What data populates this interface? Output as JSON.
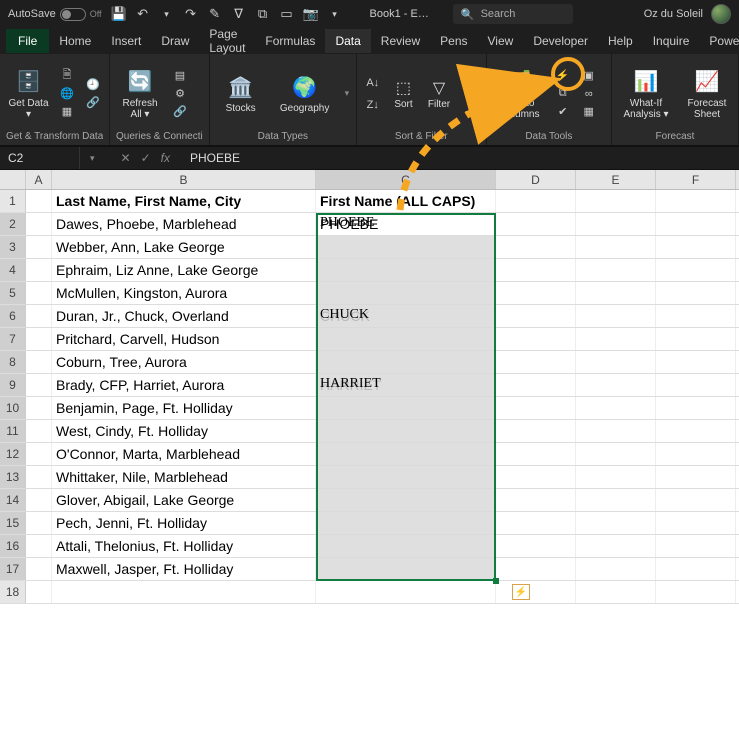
{
  "titlebar": {
    "autosave_label": "AutoSave",
    "autosave_state": "Off",
    "doc_title": "Book1 - E…",
    "search_placeholder": "Search",
    "user_name": "Oz du Soleil"
  },
  "tabs": [
    "File",
    "Home",
    "Insert",
    "Draw",
    "Page Layout",
    "Formulas",
    "Data",
    "Review",
    "Pens",
    "View",
    "Developer",
    "Help",
    "Inquire",
    "Power"
  ],
  "active_tab": "Data",
  "ribbon": {
    "groups": [
      {
        "label": "Get & Transform Data",
        "items": [
          {
            "name": "Get Data ▾"
          }
        ]
      },
      {
        "label": "Queries & Connecti...",
        "items": [
          {
            "name": "Refresh All ▾"
          }
        ]
      },
      {
        "label": "Data Types",
        "items": [
          {
            "name": "Stocks"
          },
          {
            "name": "Geography"
          }
        ]
      },
      {
        "label": "Sort & Filter",
        "items": [
          {
            "name": "Sort"
          },
          {
            "name": "Filter"
          }
        ]
      },
      {
        "label": "Data Tools",
        "items": [
          {
            "name": "Text to Columns"
          }
        ]
      },
      {
        "label": "Forecast",
        "items": [
          {
            "name": "What-If Analysis ▾"
          },
          {
            "name": "Forecast Sheet"
          }
        ]
      }
    ]
  },
  "formula_bar": {
    "name_box": "C2",
    "value": "PHOEBE"
  },
  "columns": [
    "A",
    "B",
    "C",
    "D",
    "E",
    "F"
  ],
  "rows": [
    {
      "n": 1,
      "b": "Last Name, First Name, City",
      "c": "First Name (ALL CAPS)"
    },
    {
      "n": 2,
      "b": "Dawes, Phoebe, Marblehead",
      "c": "PHOEBE"
    },
    {
      "n": 3,
      "b": "Webber, Ann, Lake George",
      "c": ""
    },
    {
      "n": 4,
      "b": "Ephraim, Liz Anne, Lake George",
      "c": ""
    },
    {
      "n": 5,
      "b": "McMullen, Kingston, Aurora",
      "c": ""
    },
    {
      "n": 6,
      "b": "Duran, Jr., Chuck, Overland",
      "c": "CHUCK"
    },
    {
      "n": 7,
      "b": "Pritchard, Carvell, Hudson",
      "c": ""
    },
    {
      "n": 8,
      "b": "Coburn, Tree, Aurora",
      "c": ""
    },
    {
      "n": 9,
      "b": "Brady, CFP, Harriet, Aurora",
      "c": "HARRIET"
    },
    {
      "n": 10,
      "b": "Benjamin, Page, Ft. Holliday",
      "c": ""
    },
    {
      "n": 11,
      "b": "West, Cindy, Ft. Holliday",
      "c": ""
    },
    {
      "n": 12,
      "b": "O'Connor, Marta, Marblehead",
      "c": ""
    },
    {
      "n": 13,
      "b": "Whittaker, Nile, Marblehead",
      "c": ""
    },
    {
      "n": 14,
      "b": "Glover, Abigail, Lake George",
      "c": ""
    },
    {
      "n": 15,
      "b": "Pech, Jenni, Ft. Holliday",
      "c": ""
    },
    {
      "n": 16,
      "b": "Attali, Thelonius, Ft. Holliday",
      "c": ""
    },
    {
      "n": 17,
      "b": "Maxwell, Jasper, Ft. Holliday",
      "c": ""
    },
    {
      "n": 18,
      "b": "",
      "c": ""
    }
  ]
}
